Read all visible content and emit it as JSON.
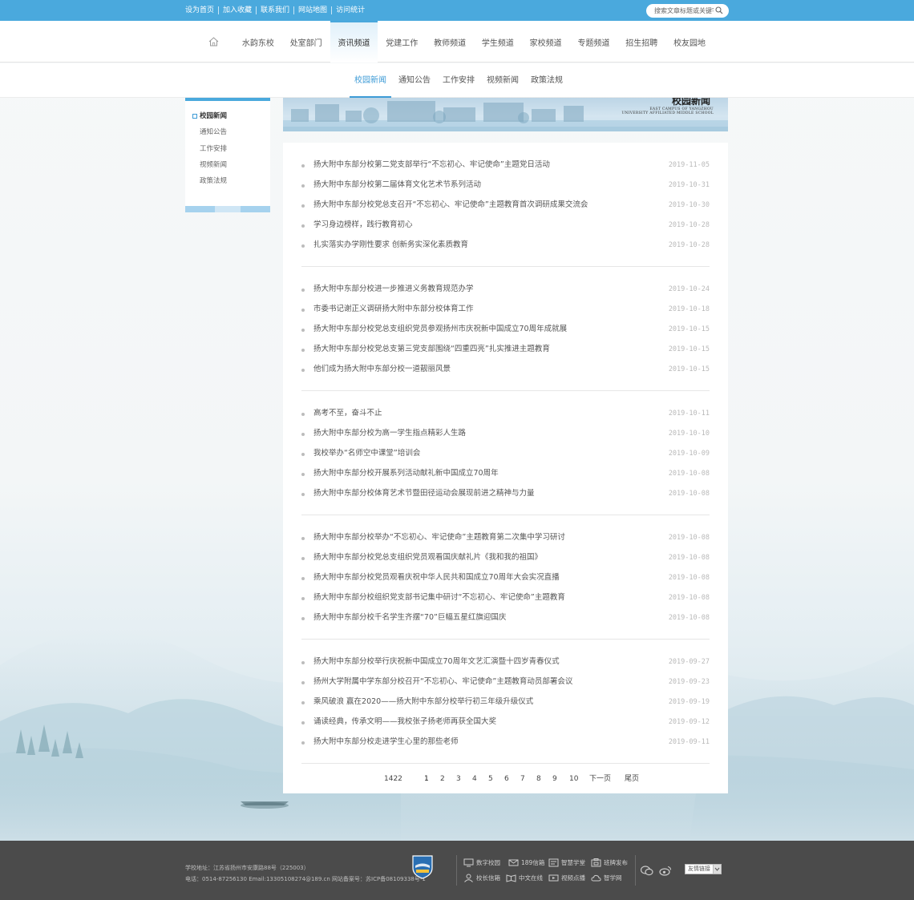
{
  "toplinks": [
    "设为首页",
    "加入收藏",
    "联系我们",
    "网站地图",
    "访问统计"
  ],
  "search": {
    "placeholder": "搜索文章标题或关键字"
  },
  "nav": {
    "items": [
      "水韵东校",
      "处室部门",
      "资讯频道",
      "党建工作",
      "教师频道",
      "学生频道",
      "家校频道",
      "专题频道",
      "招生招聘",
      "校友园地"
    ],
    "active": "资讯频道"
  },
  "subnav": {
    "items": [
      "校园新闻",
      "通知公告",
      "工作安排",
      "视频新闻",
      "政策法规"
    ],
    "active": "校园新闻"
  },
  "sidebar": {
    "items": [
      "校园新闻",
      "通知公告",
      "工作安排",
      "视频新闻",
      "政策法规"
    ],
    "active": "校园新闻"
  },
  "banner": {
    "title": "校园新闻",
    "en_line1": "EAST CAMPUS OF YANGZHOU",
    "en_line2": "UNIVERSITY AFFILIATED MIDDLE SCHOOL"
  },
  "news_groups": [
    [
      {
        "title": "扬大附中东部分校第二党支部举行“不忘初心、牢记使命”主题党日活动",
        "date": "2019-11-05"
      },
      {
        "title": "扬大附中东部分校第二届体育文化艺术节系列活动",
        "date": "2019-10-31"
      },
      {
        "title": "扬大附中东部分校党总支召开“不忘初心、牢记使命”主题教育首次调研成果交流会",
        "date": "2019-10-30"
      },
      {
        "title": "学习身边榜样，践行教育初心",
        "date": "2019-10-28"
      },
      {
        "title": "扎实落实办学刚性要求 创新务实深化素质教育",
        "date": "2019-10-28"
      }
    ],
    [
      {
        "title": "扬大附中东部分校进一步推进义务教育规范办学",
        "date": "2019-10-24"
      },
      {
        "title": "市委书记谢正义调研扬大附中东部分校体育工作",
        "date": "2019-10-18"
      },
      {
        "title": "扬大附中东部分校党总支组织党员参观扬州市庆祝新中国成立70周年成就展",
        "date": "2019-10-15"
      },
      {
        "title": "扬大附中东部分校党总支第三党支部围绕“四重四亮”扎实推进主题教育",
        "date": "2019-10-15"
      },
      {
        "title": "他们成为扬大附中东部分校一道靓丽风景",
        "date": "2019-10-15"
      }
    ],
    [
      {
        "title": "高考不至，奋斗不止",
        "date": "2019-10-11"
      },
      {
        "title": "扬大附中东部分校为高一学生指点精彩人生路",
        "date": "2019-10-10"
      },
      {
        "title": "我校举办“名师空中课堂”培训会",
        "date": "2019-10-09"
      },
      {
        "title": "扬大附中东部分校开展系列活动献礼新中国成立70周年",
        "date": "2019-10-08"
      },
      {
        "title": "扬大附中东部分校体育艺术节暨田径运动会展现前进之精神与力量",
        "date": "2019-10-08"
      }
    ],
    [
      {
        "title": "扬大附中东部分校举办“不忘初心、牢记使命”主题教育第二次集中学习研讨",
        "date": "2019-10-08"
      },
      {
        "title": "扬大附中东部分校党总支组织党员观看国庆献礼片《我和我的祖国》",
        "date": "2019-10-08"
      },
      {
        "title": "扬大附中东部分校党员观看庆祝中华人民共和国成立70周年大会实况直播",
        "date": "2019-10-08"
      },
      {
        "title": "扬大附中东部分校组织党支部书记集中研讨“不忘初心、牢记使命”主题教育",
        "date": "2019-10-08"
      },
      {
        "title": "扬大附中东部分校千名学生齐摆“70”巨幅五星红旗迎国庆",
        "date": "2019-10-08"
      }
    ],
    [
      {
        "title": "扬大附中东部分校举行庆祝新中国成立70周年文艺汇演暨十四岁青春仪式",
        "date": "2019-09-27"
      },
      {
        "title": "扬州大学附属中学东部分校召开“不忘初心、牢记使命”主题教育动员部署会议",
        "date": "2019-09-23"
      },
      {
        "title": "乘风破浪 赢在2020——扬大附中东部分校举行初三年级升级仪式",
        "date": "2019-09-19"
      },
      {
        "title": "诵读经典，传承文明——我校张子扬老师再获全国大奖",
        "date": "2019-09-12"
      },
      {
        "title": "扬大附中东部分校走进学生心里的那些老师",
        "date": "2019-09-11"
      }
    ]
  ],
  "pager": {
    "total": "1422",
    "pages": [
      "1",
      "2",
      "3",
      "4",
      "5",
      "6",
      "7",
      "8",
      "9",
      "10"
    ],
    "current": "1",
    "next": "下一页",
    "last": "尾页"
  },
  "footer": {
    "address": "学校地址：江苏省扬州市安康路88号（225003）",
    "contact": "电话：0514-87256130 Email:13305108274@189.cn 网站备案号：苏ICP备08109338号-1",
    "links": [
      {
        "label": "数字校园",
        "icon": "monitor-icon"
      },
      {
        "label": "189信箱",
        "icon": "mail-189-icon"
      },
      {
        "label": "智慧学堂",
        "icon": "classroom-icon"
      },
      {
        "label": "班牌发布",
        "icon": "board-icon"
      },
      {
        "label": "校长信箱",
        "icon": "user-mail-icon"
      },
      {
        "label": "中文在线",
        "icon": "book-icon"
      },
      {
        "label": "视频点播",
        "icon": "video-icon"
      },
      {
        "label": "智学网",
        "icon": "cloud-icon"
      }
    ],
    "friend_links": "友情链接"
  },
  "colors": {
    "accent": "#4aa9dd",
    "footer_bg": "#4b4b4b",
    "active_text": "#3d9bd6"
  }
}
